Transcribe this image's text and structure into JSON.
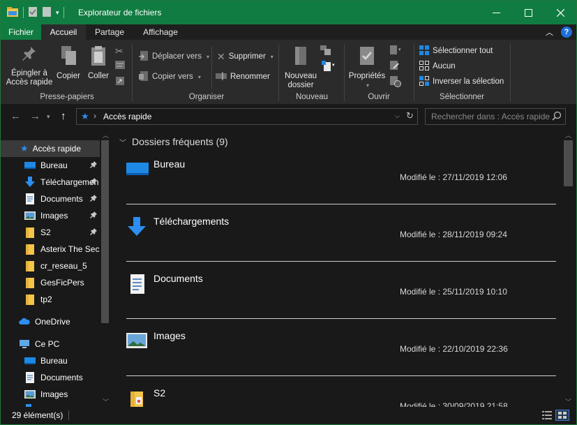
{
  "window": {
    "title": "Explorateur de fichiers"
  },
  "ribbon_tabs": [
    "Fichier",
    "Accueil",
    "Partage",
    "Affichage"
  ],
  "ribbon": {
    "presse_papiers": {
      "label": "Presse-papiers",
      "pin_line1": "Épingler à",
      "pin_line2": "Accès rapide",
      "copy": "Copier",
      "paste": "Coller"
    },
    "organiser": {
      "label": "Organiser",
      "move_to": "Déplacer vers",
      "copy_to": "Copier vers",
      "delete": "Supprimer",
      "rename": "Renommer"
    },
    "nouveau": {
      "label": "Nouveau",
      "new_folder_line1": "Nouveau",
      "new_folder_line2": "dossier"
    },
    "ouvrir": {
      "label": "Ouvrir",
      "properties": "Propriétés"
    },
    "selectionner": {
      "label": "Sélectionner",
      "select_all": "Sélectionner tout",
      "select_none": "Aucun",
      "invert": "Inverser la sélection"
    }
  },
  "address": {
    "path": "Accès rapide",
    "search_placeholder": "Rechercher dans : Accès rapide"
  },
  "nav": {
    "quick_access": "Accès rapide",
    "items": [
      {
        "label": "Bureau",
        "pinned": true,
        "icon": "desktop-icon"
      },
      {
        "label": "Téléchargements",
        "pinned": true,
        "icon": "download-icon"
      },
      {
        "label": "Documents",
        "pinned": true,
        "icon": "documents-icon"
      },
      {
        "label": "Images",
        "pinned": true,
        "icon": "images-icon"
      },
      {
        "label": "S2",
        "pinned": true,
        "icon": "folder-icon"
      },
      {
        "label": "Asterix The Secret",
        "pinned": false,
        "icon": "folder-icon"
      },
      {
        "label": "cr_reseau_5",
        "pinned": false,
        "icon": "folder-icon"
      },
      {
        "label": "GesFicPers",
        "pinned": false,
        "icon": "folder-icon"
      },
      {
        "label": "tp2",
        "pinned": false,
        "icon": "folder-icon"
      }
    ],
    "onedrive": "OneDrive",
    "this_pc": "Ce PC",
    "pc_items": [
      {
        "label": "Bureau",
        "icon": "desktop-icon"
      },
      {
        "label": "Documents",
        "icon": "documents-icon"
      },
      {
        "label": "Images",
        "icon": "images-icon"
      }
    ]
  },
  "content": {
    "group_title": "Dossiers fréquents (9)",
    "folders": [
      {
        "name": "Bureau",
        "modified": "Modifié le : 27/11/2019 12:06",
        "icon": "desktop-icon"
      },
      {
        "name": "Téléchargements",
        "modified": "Modifié le : 28/11/2019 09:24",
        "icon": "download-icon"
      },
      {
        "name": "Documents",
        "modified": "Modifié le : 25/11/2019 10:10",
        "icon": "documents-icon"
      },
      {
        "name": "Images",
        "modified": "Modifié le : 22/10/2019 22:36",
        "icon": "images-icon"
      },
      {
        "name": "S2",
        "modified": "Modifié le : 30/09/2019 21:58",
        "icon": "folder-icon"
      }
    ]
  },
  "status": {
    "count": "29 élément(s)"
  },
  "colors": {
    "accent": "#107c41",
    "background": "#191919",
    "ribbon": "#2b2b2b"
  }
}
